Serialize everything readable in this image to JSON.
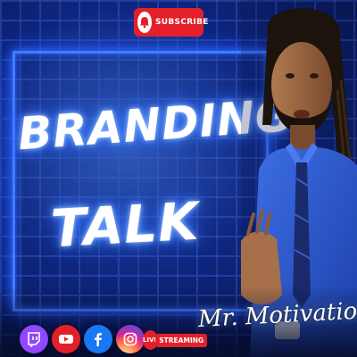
{
  "title": {
    "line1": "BRANDING",
    "line2": "TALK"
  },
  "subscribe": {
    "label": "SUBSCRIBE",
    "icon": "bell-icon",
    "color": "#e3202a"
  },
  "signature": "Mr. Motivation",
  "social": [
    {
      "name": "twitch",
      "icon": "twitch-icon",
      "color": "#9146ff"
    },
    {
      "name": "youtube",
      "icon": "youtube-icon",
      "color": "#e3202a"
    },
    {
      "name": "facebook",
      "icon": "facebook-icon",
      "color": "#1877f2"
    },
    {
      "name": "instagram",
      "icon": "instagram-icon",
      "color": "#d62976"
    }
  ],
  "live": {
    "badge": "LIVE",
    "text": "STREAMING"
  },
  "colors": {
    "neon": "#3f7dff",
    "background": "#0b1f6b",
    "shirt": "#2f5fd8"
  }
}
